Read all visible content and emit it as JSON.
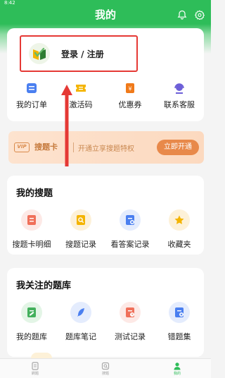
{
  "status_bar": {
    "time": "8:42"
  },
  "header": {
    "title": "我的"
  },
  "user": {
    "login_label": "登录 / 注册"
  },
  "quick_actions": [
    {
      "label": "我的订单",
      "icon": "order-icon",
      "color": "#4a7ff0"
    },
    {
      "label": "激活码",
      "icon": "ticket-icon",
      "color": "#f4b400"
    },
    {
      "label": "优惠券",
      "icon": "coupon-icon",
      "color": "#f07a1a"
    },
    {
      "label": "联系客服",
      "icon": "headset-icon",
      "color": "#6d5fd8"
    }
  ],
  "vip": {
    "badge": "VIP",
    "name": "搜题卡",
    "desc": "开通立享搜题特权",
    "button": "立即开通"
  },
  "my_search": {
    "title": "我的搜题",
    "items": [
      {
        "label": "搜题卡明细",
        "icon": "card-detail-icon"
      },
      {
        "label": "搜题记录",
        "icon": "search-record-icon"
      },
      {
        "label": "看答案记录",
        "icon": "answer-record-icon"
      },
      {
        "label": "收藏夹",
        "icon": "star-icon"
      }
    ]
  },
  "question_bank": {
    "title": "我关注的题库",
    "items": [
      {
        "label": "我的题库",
        "icon": "bank-edit-icon"
      },
      {
        "label": "题库笔记",
        "icon": "feather-icon"
      },
      {
        "label": "测试记录",
        "icon": "test-record-icon"
      },
      {
        "label": "错题集",
        "icon": "wrong-set-icon"
      }
    ]
  },
  "tabs": [
    {
      "label": "刷题",
      "icon": "practice-icon"
    },
    {
      "label": "搜题",
      "icon": "search-question-icon"
    },
    {
      "label": "我的",
      "icon": "profile-icon"
    }
  ],
  "colors": {
    "brand_green": "#2ebd59",
    "highlight_red": "#e53935",
    "vip_orange": "#e8894a"
  }
}
